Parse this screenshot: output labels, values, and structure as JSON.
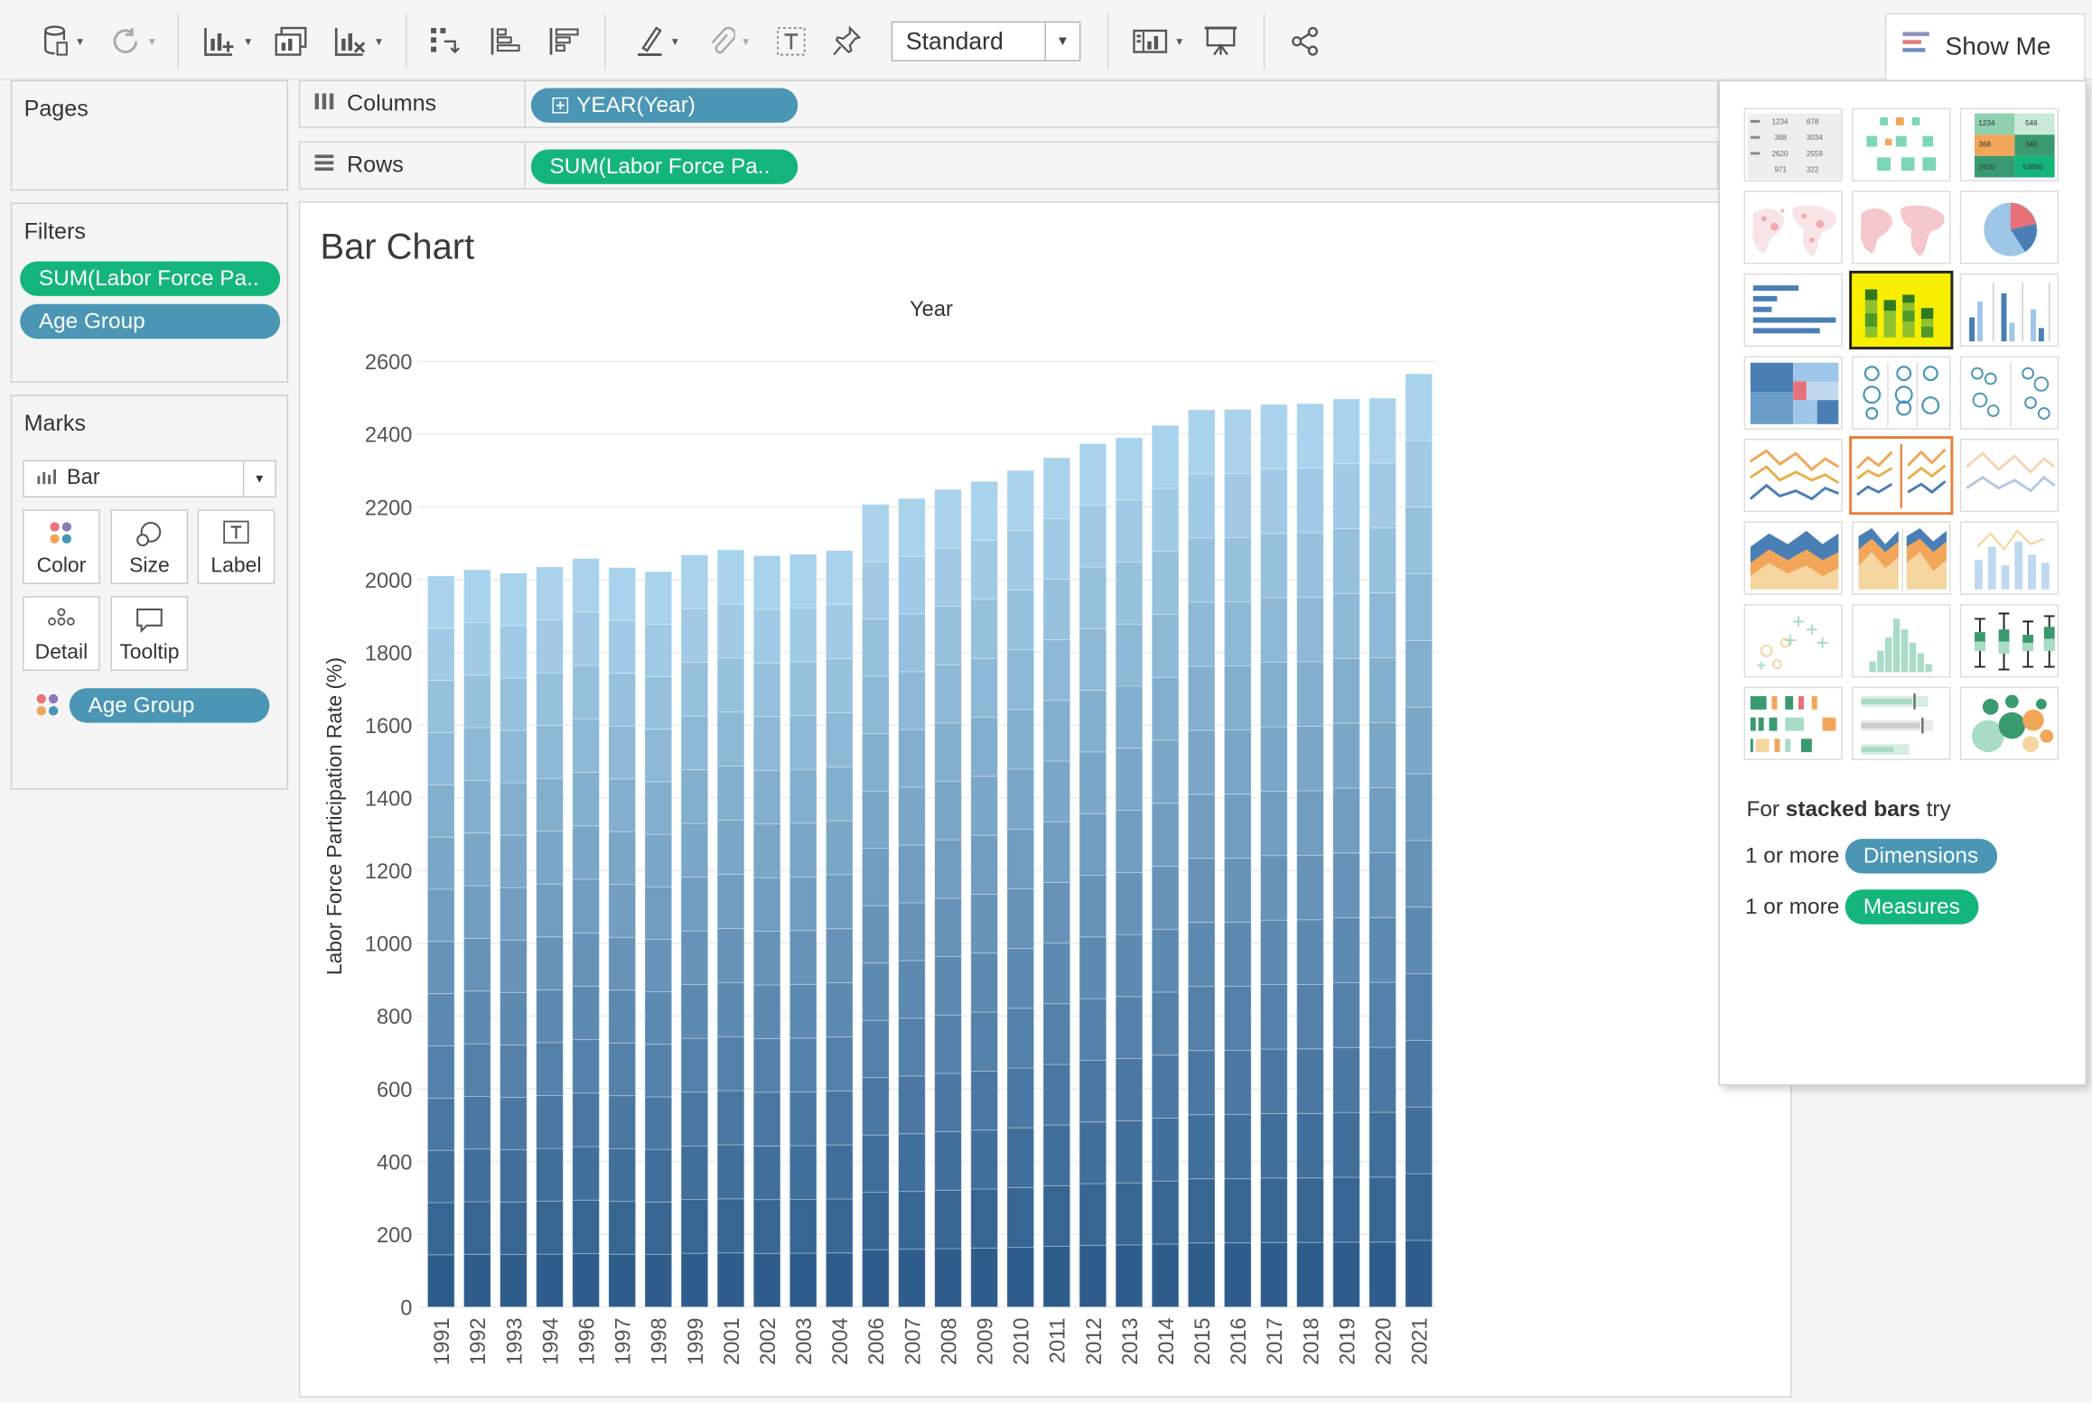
{
  "toolbar": {
    "fit_value": "Standard",
    "icons": [
      "datasource-icon",
      "refresh-icon",
      "new-worksheet-icon",
      "duplicate-sheet-icon",
      "clear-sheet-icon",
      "swap-rows-columns-icon",
      "sort-ascending-icon",
      "sort-descending-icon",
      "highlight-icon",
      "group-icon",
      "label-icon",
      "pin-icon",
      "show-cards-icon",
      "presentation-icon",
      "share-icon"
    ]
  },
  "show_me_tab": {
    "label": "Show Me"
  },
  "pages_card": {
    "title": "Pages"
  },
  "filters_card": {
    "title": "Filters",
    "pills": [
      {
        "label": "SUM(Labor Force Pa..",
        "color": "#14b57b"
      },
      {
        "label": "Age Group",
        "color": "#4a96b4"
      }
    ]
  },
  "marks_card": {
    "title": "Marks",
    "mark_type": "Bar",
    "buttons": [
      "Color",
      "Size",
      "Label",
      "Detail",
      "Tooltip"
    ],
    "color_pill": "Age Group"
  },
  "shelves": {
    "columns": {
      "label": "Columns",
      "pill": "YEAR(Year)"
    },
    "rows": {
      "label": "Rows",
      "pill": "SUM(Labor Force Pa.."
    }
  },
  "view": {
    "title": "Bar Chart"
  },
  "show_me_panel": {
    "hint_prefix": "For ",
    "hint_bold": "stacked bars",
    "hint_suffix": " try",
    "req_dimensions_prefix": "1 or more",
    "req_dimensions_label": "Dimensions",
    "req_measures_prefix": "1 or more",
    "req_measures_label": "Measures",
    "selected_thumb": "stacked-bars",
    "thumb_labels": {
      "text_table": [
        "1234",
        "678",
        "368",
        "3034",
        "2620",
        "2559",
        "971",
        "322"
      ],
      "highlight_table": [
        "1234",
        "546",
        "368",
        "340",
        "2620",
        "53890"
      ]
    }
  },
  "chart_data": {
    "type": "bar",
    "stacked": true,
    "title": "",
    "xlabel": "Year",
    "ylabel": "Labor Force Participation Rate (%)",
    "ylim": [
      0,
      2600
    ],
    "yticks": [
      0,
      200,
      400,
      600,
      800,
      1000,
      1200,
      1400,
      1600,
      1800,
      2000,
      2200,
      2400,
      2600
    ],
    "grid": true,
    "categories": [
      "1991",
      "1992",
      "1993",
      "1994",
      "1996",
      "1997",
      "1998",
      "1999",
      "2001",
      "2002",
      "2003",
      "2004",
      "2006",
      "2007",
      "2008",
      "2009",
      "2010",
      "2011",
      "2012",
      "2013",
      "2014",
      "2015",
      "2016",
      "2017",
      "2018",
      "2019",
      "2020",
      "2021"
    ],
    "totals": [
      2010,
      2027,
      2018,
      2035,
      2058,
      2033,
      2022,
      2068,
      2082,
      2066,
      2070,
      2080,
      2207,
      2223,
      2248,
      2270,
      2300,
      2335,
      2374,
      2390,
      2424,
      2467,
      2468,
      2482,
      2484,
      2497,
      2499,
      2566
    ],
    "colors": {
      "palette_dark": "#2e5d8c",
      "palette_light": "#a9d3ec"
    }
  }
}
